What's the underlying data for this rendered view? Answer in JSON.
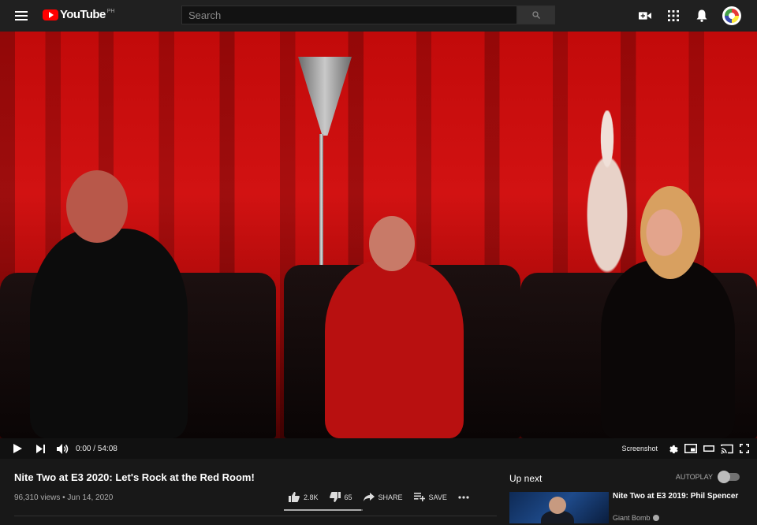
{
  "header": {
    "logo_text": "YouTube",
    "country": "PH",
    "search_placeholder": "Search"
  },
  "icons": {
    "menu": "menu-icon",
    "search": "search-icon",
    "create": "video-camera-icon",
    "apps": "apps-grid-icon",
    "notifications": "bell-icon",
    "avatar": "avatar"
  },
  "player": {
    "time_display": "0:00 / 54:08",
    "screenshot_label": "Screenshot"
  },
  "video": {
    "title": "Nite Two at E3 2020: Let's Rock at the Red Room!",
    "views_date": "96,310 views • Jun 14, 2020",
    "likes": "2.8K",
    "dislikes": "65",
    "share_label": "SHARE",
    "save_label": "SAVE",
    "like_ratio": 0.977
  },
  "sidebar": {
    "up_next_label": "Up next",
    "autoplay_label": "AUTOPLAY",
    "autoplay_on": false,
    "next_video": {
      "title": "Nite Two at E3 2019: Phil Spencer",
      "channel": "Giant Bomb"
    }
  },
  "colors": {
    "background": "#181818",
    "topbar": "#202020",
    "brand_red": "#ff0000",
    "video_red": "#c20a0a"
  }
}
